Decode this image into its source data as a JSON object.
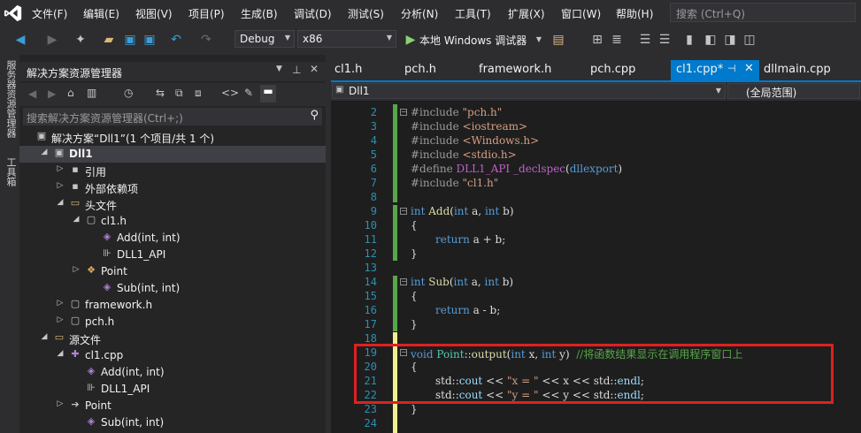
{
  "menubar": {
    "items": [
      "文件(F)",
      "编辑(E)",
      "视图(V)",
      "项目(P)",
      "生成(B)",
      "调试(D)",
      "测试(S)",
      "分析(N)",
      "工具(T)",
      "扩展(X)",
      "窗口(W)",
      "帮助(H)"
    ],
    "search_placeholder": "搜索 (Ctrl+Q)"
  },
  "toolbar": {
    "config": "Debug",
    "platform": "x86",
    "run_label": "本地 Windows 调试器"
  },
  "left_strip": {
    "items": [
      "服务器资源管理器",
      "工具箱"
    ]
  },
  "solution_explorer": {
    "title": "解决方案资源管理器",
    "search_placeholder": "搜索解决方案资源管理器(Ctrl+;)",
    "tree": [
      {
        "label": "解决方案“Dll1”(1 个项目/共 1 个)",
        "icon": "solution-icon",
        "expander": ""
      },
      {
        "label": "Dll1",
        "icon": "project-icon",
        "expander": "▲"
      },
      {
        "label": "引用",
        "icon": "references-icon",
        "expander": "▶"
      },
      {
        "label": "外部依赖项",
        "icon": "external-deps-icon",
        "expander": "▶"
      },
      {
        "label": "头文件",
        "icon": "folder-icon",
        "expander": "▲"
      },
      {
        "label": "cl1.h",
        "icon": "header-file-icon",
        "expander": "▲"
      },
      {
        "label": "Add(int, int)",
        "icon": "method-icon",
        "expander": ""
      },
      {
        "label": "DLL1_API",
        "icon": "macro-icon",
        "expander": ""
      },
      {
        "label": "Point",
        "icon": "class-icon",
        "expander": "▶"
      },
      {
        "label": "Sub(int, int)",
        "icon": "method-icon",
        "expander": ""
      },
      {
        "label": "framework.h",
        "icon": "header-file-icon",
        "expander": "▶"
      },
      {
        "label": "pch.h",
        "icon": "header-file-icon",
        "expander": "▶"
      },
      {
        "label": "源文件",
        "icon": "folder-icon",
        "expander": "▲"
      },
      {
        "label": "cl1.cpp",
        "icon": "cpp-file-icon",
        "expander": "▲"
      },
      {
        "label": "Add(int, int)",
        "icon": "method-icon",
        "expander": ""
      },
      {
        "label": "DLL1_API",
        "icon": "macro-icon",
        "expander": ""
      },
      {
        "label": "Point",
        "icon": "arrow-icon",
        "expander": "▶"
      },
      {
        "label": "Sub(int, int)",
        "icon": "method-icon",
        "expander": ""
      }
    ]
  },
  "tabs": [
    "cl1.h",
    "pch.h",
    "framework.h",
    "pch.cpp",
    "cl1.cpp*",
    "dllmain.cpp"
  ],
  "active_tab": "cl1.cpp*",
  "navbar": {
    "project": "Dll1",
    "scope": "(全局范围)"
  },
  "editor": {
    "line_numbers": [
      "2",
      "3",
      "4",
      "5",
      "6",
      "7",
      "8",
      "9",
      "10",
      "11",
      "12",
      "13",
      "14",
      "15",
      "16",
      "17",
      "18",
      "19",
      "20",
      "21",
      "22",
      "23",
      "24"
    ],
    "lines": [
      "#include \"pch.h\"",
      "#include <iostream>",
      "#include <Windows.h>",
      "#include <stdio.h>",
      "#define DLL1_API _declspec(dllexport)",
      "#include \"cl1.h\"",
      "",
      "int Add(int a, int b)",
      "{",
      "return a + b;",
      "}",
      "",
      "int Sub(int a, int b)",
      "{",
      "return a - b;",
      "}",
      "",
      "void Point::output(int x, int y)  //将函数结果显示在调用程序窗口上",
      "{",
      "std::cout << \"x = \" << x << std::endl;",
      "std::cout << \"y = \" << y << std::endl;",
      "}",
      ""
    ]
  },
  "colors": {
    "accent": "#007acc",
    "highlight_box": "#e02020",
    "line_number": "#2b91af",
    "keyword": "#569cd6",
    "comment": "#57a64a"
  }
}
